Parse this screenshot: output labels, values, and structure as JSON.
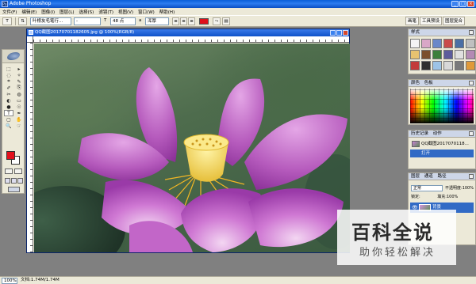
{
  "app": {
    "title": "Adobe Photoshop",
    "window_controls": [
      "_",
      "□",
      "×"
    ]
  },
  "menu": [
    "文件(F)",
    "编辑(E)",
    "图像(I)",
    "图层(L)",
    "选择(S)",
    "滤镜(T)",
    "视图(V)",
    "窗口(W)",
    "帮助(H)"
  ],
  "options": {
    "tool_glyph": "T",
    "orient_glyph": "⇅",
    "font_family": "叶根友毛笔行…",
    "font_style": "-",
    "size_glyph": "T",
    "font_size": "48 点",
    "aa_glyph": "a",
    "antialias": "浑厚",
    "align_left": "≡",
    "align_center": "≡",
    "align_right": "≡",
    "warp": "⤳",
    "palette": "▤",
    "text_color": "#e0101b",
    "panel_tabs": [
      "画笔",
      "工具预设",
      "图层复合"
    ]
  },
  "toolbox": {
    "tools": [
      "⬚",
      "▸",
      "◌",
      "✧",
      "⌗",
      "✎",
      "✐",
      "⎘",
      "✂",
      "◍",
      "◐",
      "▭",
      "●",
      "☉",
      "T",
      "✒",
      "▢",
      "✋",
      "🔍",
      "☞"
    ],
    "fg_color": "#e3111d",
    "bg_color": "#ffffff"
  },
  "document": {
    "title": "QQ截图20170701182605.jpg @ 100%(RGB/8)"
  },
  "panels": {
    "styles": {
      "title": "样式",
      "colors": [
        "#f4f4f4",
        "#d9a7c7",
        "#6a88c9",
        "#c94b4b",
        "#4a6fa5",
        "#c0c0c0",
        "#e8c270",
        "#7b4f2c",
        "#3c7f3c",
        "#5c5c9c",
        "#e0e0e0",
        "#b48ab4",
        "#c23b3b",
        "#2f2f2f",
        "#9dc3e6",
        "#d8d8d8",
        "#7a7a7a",
        "#e09a3a"
      ]
    },
    "swatches": {
      "title": "颜色",
      "tab2": "色板"
    },
    "history": {
      "title": "历史记录",
      "tab2": "动作",
      "snapshot": "QQ截图2017070118...",
      "step": "打开"
    },
    "layers": {
      "title": "图层",
      "tab2": "通道",
      "tab3": "路径",
      "blend": "正常",
      "opacity_label": "不透明度:",
      "opacity": "100%",
      "lock_label": "锁定:",
      "fill_label": "填充:",
      "fill": "100%",
      "layer_name": "背景",
      "eye": "👁"
    }
  },
  "status": {
    "zoom": "100%",
    "doc_size": "文档:1.74M/1.74M"
  },
  "watermark": {
    "main": "百科全说",
    "sub": "助你轻松解决"
  }
}
